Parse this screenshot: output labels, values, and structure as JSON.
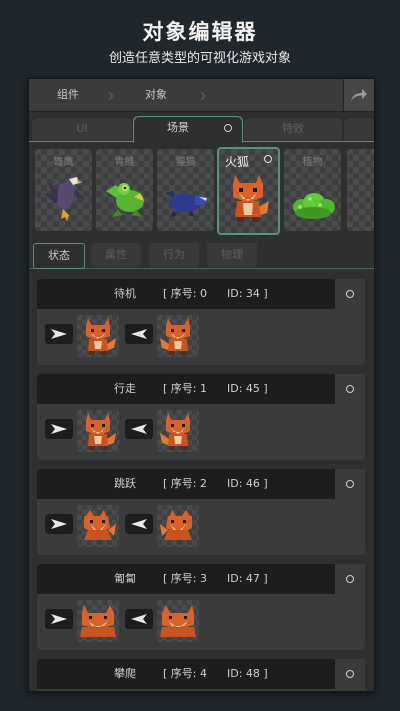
{
  "header": {
    "title": "对象编辑器",
    "subtitle": "创造任意类型的可视化游戏对象"
  },
  "breadcrumb": {
    "items": [
      "组件",
      "对象"
    ],
    "share_icon": "share-icon"
  },
  "category_tabs": [
    {
      "label": "UI",
      "active": false
    },
    {
      "label": "场景",
      "active": true
    },
    {
      "label": "特效",
      "active": false
    }
  ],
  "sprites": [
    {
      "label": "雄鹰",
      "icon": "eagle-sprite"
    },
    {
      "label": "青蛙",
      "icon": "frog-sprite"
    },
    {
      "label": "獾猫",
      "icon": "badger-sprite"
    },
    {
      "label": "火狐",
      "icon": "fox-sprite",
      "selected": true
    },
    {
      "label": "植物",
      "icon": "plant-sprite"
    }
  ],
  "state_tabs": [
    {
      "label": "状态",
      "active": true
    },
    {
      "label": "属性",
      "active": false
    },
    {
      "label": "行为",
      "active": false
    },
    {
      "label": "物理",
      "active": false
    }
  ],
  "animations": [
    {
      "name": "待机",
      "index": "[ 序号: 0",
      "id": "ID: 34 ]"
    },
    {
      "name": "行走",
      "index": "[ 序号: 1",
      "id": "ID: 45 ]"
    },
    {
      "name": "跳跃",
      "index": "[ 序号: 2",
      "id": "ID: 46 ]"
    },
    {
      "name": "匍匐",
      "index": "[ 序号: 3",
      "id": "ID: 47 ]"
    },
    {
      "name": "攀爬",
      "index": "[ 序号: 4",
      "id": "ID: 48 ]"
    }
  ],
  "colors": {
    "accent": "#5a8f79",
    "fox": "#d9622b",
    "fox_light": "#f0c9a0"
  }
}
